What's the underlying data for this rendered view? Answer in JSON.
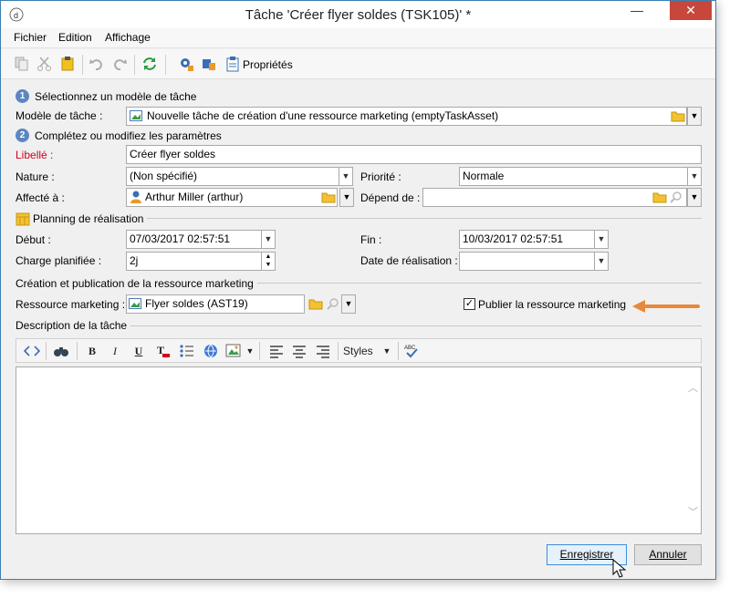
{
  "window": {
    "title": "Tâche 'Créer flyer soldes (TSK105)' *",
    "close_symbol": "✕",
    "minimize_symbol": "—",
    "maximize_symbol": "☐"
  },
  "menu": {
    "items": [
      "Fichier",
      "Edition",
      "Affichage"
    ]
  },
  "toolbar": {
    "properties_label": "Propriétés"
  },
  "step1": {
    "number": "1",
    "title": "Sélectionnez un modèle de tâche",
    "model_label": "Modèle de tâche :",
    "model_value": "Nouvelle tâche de création d'une ressource marketing (emptyTaskAsset)"
  },
  "step2": {
    "number": "2",
    "title": "Complétez ou modifiez les paramètres",
    "libelle_label": "Libellé :",
    "libelle_value": "Créer flyer soldes",
    "nature_label": "Nature :",
    "nature_value": "(Non spécifié)",
    "priorite_label": "Priorité :",
    "priorite_value": "Normale",
    "affecte_label": "Affecté à :",
    "affecte_value": "Arthur Miller (arthur)",
    "depend_label": "Dépend de :",
    "depend_value": ""
  },
  "planning": {
    "title": "Planning de réalisation",
    "debut_label": "Début :",
    "debut_value": "07/03/2017 02:57:51",
    "fin_label": "Fin :",
    "fin_value": "10/03/2017 02:57:51",
    "charge_label": "Charge planifiée :",
    "charge_value": "2j",
    "date_real_label": "Date de réalisation :",
    "date_real_value": ""
  },
  "resource": {
    "title": "Création et publication de la ressource marketing",
    "label": "Ressource marketing :",
    "value": "Flyer soldes (AST19)",
    "publish_label": "Publier la ressource marketing",
    "publish_checked": true
  },
  "description": {
    "title": "Description de la tâche",
    "styles_label": "Styles"
  },
  "buttons": {
    "save": "Enregistrer",
    "cancel": "Annuler"
  },
  "colors": {
    "accent_arrow": "#e8883a",
    "title_close": "#c7473a",
    "step_circle": "#5b86c3",
    "required_label": "#d0021b"
  }
}
